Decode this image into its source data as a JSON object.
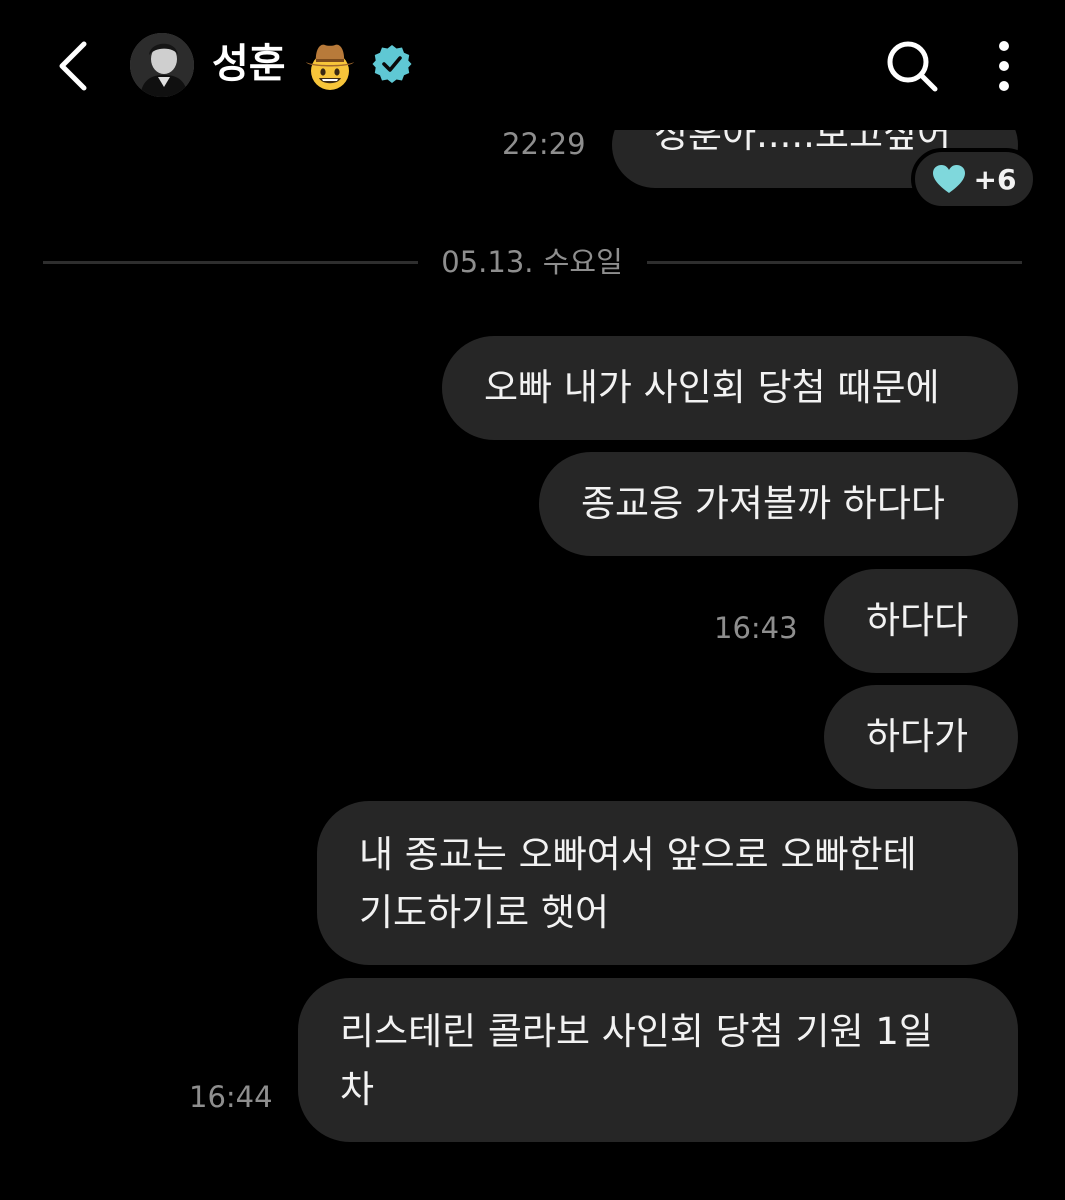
{
  "header": {
    "contact_name": "성훈",
    "emoji": "cowboy-hat-face",
    "verified": true,
    "icons": {
      "back": "chevron-left-icon",
      "search": "search-icon",
      "more": "more-vertical-icon",
      "verified": "verified-badge-icon"
    }
  },
  "messages_top": {
    "partial_text": "성훈아.....보고싶어",
    "time": "22:29",
    "reaction": {
      "icon": "heart-icon",
      "color": "#7fd8dc",
      "count": "+6"
    }
  },
  "divider": {
    "date": "05.13. 수요일"
  },
  "messages": [
    {
      "lines": [
        "오빠 내가 사인회 당첨 때문에"
      ]
    },
    {
      "lines": [
        "종교응 가져볼까 하다다"
      ]
    },
    {
      "lines": [
        "하다다"
      ],
      "time": "16:43"
    },
    {
      "lines": [
        "하다가"
      ]
    },
    {
      "lines": [
        "내 종교는 오빠여서 앞으로 오빠한테",
        "기도하기로 햇어"
      ]
    },
    {
      "lines": [
        "리스테린 콜라보 사인회 당첨 기원 1일",
        "차"
      ],
      "time": "16:44"
    }
  ],
  "colors": {
    "background": "#000000",
    "bubble": "#262626",
    "text": "#f2f2f2",
    "secondary_text": "#8e8e8e",
    "verified_badge": "#5fc8d4"
  }
}
